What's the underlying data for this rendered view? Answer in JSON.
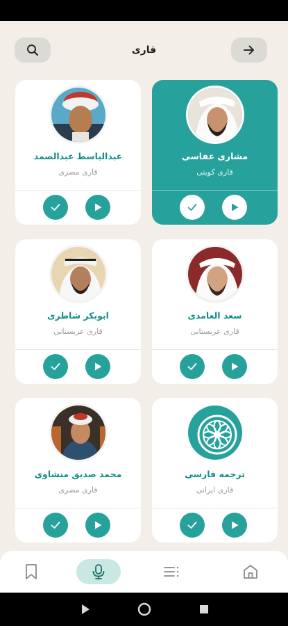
{
  "header": {
    "title": "قاری"
  },
  "reciters": [
    {
      "name": "عبدالباسط عبدالصمد",
      "role": "قاری مصری",
      "avatar": "portrait-abdulbasit",
      "active": false
    },
    {
      "name": "مشاری عفاسی",
      "role": "قاری کویتی",
      "avatar": "portrait-alafasy",
      "active": true
    },
    {
      "name": "ابوبکر شاطری",
      "role": "قاری عربستانی",
      "avatar": "portrait-shatri",
      "active": false
    },
    {
      "name": "سعد الغامدی",
      "role": "قاری عربستانی",
      "avatar": "portrait-ghamdi",
      "active": false
    },
    {
      "name": "محمد صدیق منشاوی",
      "role": "قاری مصری",
      "avatar": "portrait-minshawi",
      "active": false
    },
    {
      "name": "ترجمه فارسی",
      "role": "قاری ایرانی",
      "avatar": "rosette-logo",
      "active": false
    }
  ],
  "colors": {
    "accent": "#27a19b",
    "accent_dark": "#138f8a",
    "background": "#f3eee7",
    "nav_active": "#c9e8e3"
  },
  "bottom_nav": {
    "items": [
      "bookmark-icon",
      "microphone-icon",
      "list-icon",
      "home-icon"
    ],
    "active": "microphone-icon"
  },
  "system_nav": [
    "play-triangle-icon",
    "circle-home-icon",
    "square-recents-icon"
  ]
}
